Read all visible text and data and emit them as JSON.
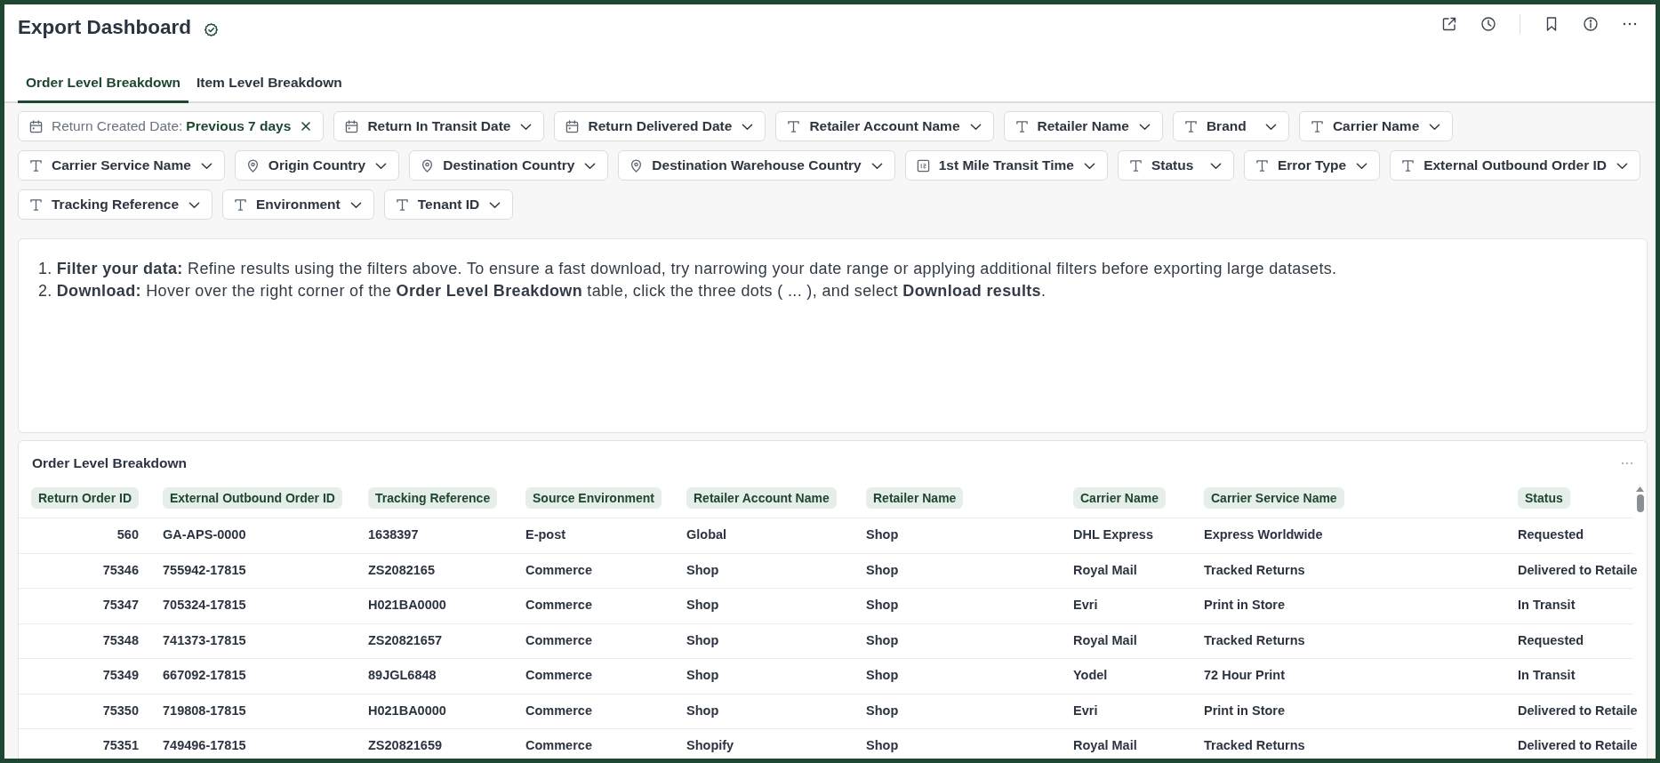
{
  "header": {
    "title": "Export Dashboard",
    "certified": true
  },
  "tabs": [
    {
      "label": "Order Level Breakdown",
      "selected": true
    },
    {
      "label": "Item Level Breakdown",
      "selected": false
    }
  ],
  "filters": [
    {
      "kind": "date",
      "label": "Return Created Date:",
      "value": "Previous 7 days"
    },
    {
      "kind": "date",
      "label": "Return In Transit Date"
    },
    {
      "kind": "date",
      "label": "Return Delivered Date"
    },
    {
      "kind": "text",
      "label": "Retailer Account Name"
    },
    {
      "kind": "text",
      "label": "Retailer Name"
    },
    {
      "kind": "text",
      "label": "Brand"
    },
    {
      "kind": "text",
      "label": "Carrier Name"
    },
    {
      "kind": "text",
      "label": "Carrier Service Name"
    },
    {
      "kind": "location",
      "label": "Origin Country"
    },
    {
      "kind": "location",
      "label": "Destination Country"
    },
    {
      "kind": "location",
      "label": "Destination Warehouse Country"
    },
    {
      "kind": "number",
      "label": "1st Mile Transit Time"
    },
    {
      "kind": "text",
      "label": "Status"
    },
    {
      "kind": "text",
      "label": "Error Type"
    },
    {
      "kind": "text",
      "label": "External Outbound Order ID"
    },
    {
      "kind": "text",
      "label": "Tracking Reference"
    },
    {
      "kind": "text",
      "label": "Environment"
    },
    {
      "kind": "text",
      "label": "Tenant ID"
    }
  ],
  "instructions": [
    {
      "number": "1.",
      "text": "**Filter your data:** Refine results using the filters above. To ensure a fast download, try narrowing your date range or applying additional filters before exporting large datasets."
    },
    {
      "number": "2.",
      "text": "**Download:** Hover over the right corner of the **Order Level Breakdown** table, click the three dots ( ... ), and select **Download results**."
    }
  ],
  "table": {
    "title": "Order Level Breakdown",
    "columns": [
      "Return Order ID",
      "External Outbound Order ID",
      "Tracking Reference",
      "Source Environment",
      "Retailer Account Name",
      "Retailer Name",
      "Carrier Name",
      "Carrier Service Name",
      "Status"
    ],
    "rows": [
      [
        "560",
        "GA-APS-0000",
        "1638397",
        "E-post",
        "Global",
        "Shop",
        "DHL Express",
        "Express Worldwide",
        "Requested"
      ],
      [
        "75346",
        "755942-17815",
        "ZS2082165",
        "Commerce",
        "Shop",
        "Shop",
        "Royal Mail",
        "Tracked Returns",
        "Delivered to Retaile"
      ],
      [
        "75347",
        "705324-17815",
        "H021BA0000",
        "Commerce",
        "Shop",
        "Shop",
        "Evri",
        "Print in Store",
        "In Transit"
      ],
      [
        "75348",
        "741373-17815",
        "ZS20821657",
        "Commerce",
        "Shop",
        "Shop",
        "Royal Mail",
        "Tracked Returns",
        "Requested"
      ],
      [
        "75349",
        "667092-17815",
        "89JGL6848",
        "Commerce",
        "Shop",
        "Shop",
        "Yodel",
        "72 Hour Print",
        "In Transit"
      ],
      [
        "75350",
        "719808-17815",
        "H021BA0000",
        "Commerce",
        "Shop",
        "Shop",
        "Evri",
        "Print in Store",
        "Delivered to Retaile"
      ],
      [
        "75351",
        "749496-17815",
        "ZS20821659",
        "Commerce",
        "Shopify",
        "Shop",
        "Royal Mail",
        "Tracked Returns",
        "Delivered to Retaile"
      ]
    ]
  }
}
